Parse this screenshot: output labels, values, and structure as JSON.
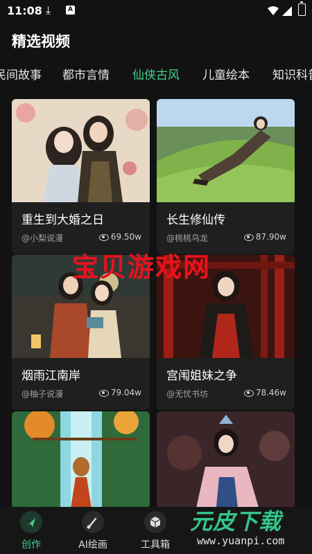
{
  "status_bar": {
    "time": "11:08",
    "download_icon": "download-icon",
    "a_badge": "A"
  },
  "header": {
    "title": "精选视频"
  },
  "tabs": [
    {
      "label": "民间故事"
    },
    {
      "label": "都市言情"
    },
    {
      "label": "仙侠古风",
      "active": true
    },
    {
      "label": "儿童绘本"
    },
    {
      "label": "知识科普"
    }
  ],
  "cards": [
    {
      "title": "重生到大婚之日",
      "author": "@小梨说漫",
      "views": "69.50w"
    },
    {
      "title": "长生修仙传",
      "author": "@桃桃乌龙",
      "views": "87.90w"
    },
    {
      "title": "烟雨江南岸",
      "author": "@柚子说漫",
      "views": "79.04w"
    },
    {
      "title": "宫闱姐妹之争",
      "author": "@无忧书坊",
      "views": "78.46w"
    },
    {
      "title": "",
      "author": "",
      "views": ""
    },
    {
      "title": "",
      "author": "",
      "views": ""
    }
  ],
  "watermark": "宝贝游戏网",
  "bottom_nav": [
    {
      "label": "创作",
      "icon": "send-icon",
      "active": true
    },
    {
      "label": "AI绘画",
      "icon": "brush-icon"
    },
    {
      "label": "工具箱",
      "icon": "cube-icon"
    }
  ],
  "corner_watermark": {
    "title": "元皮下载",
    "url": "www.yuanpi.com"
  },
  "colors": {
    "accent": "#47d18c",
    "background": "#121212",
    "card": "#1f1f1f",
    "watermark_red": "#e8121e"
  }
}
